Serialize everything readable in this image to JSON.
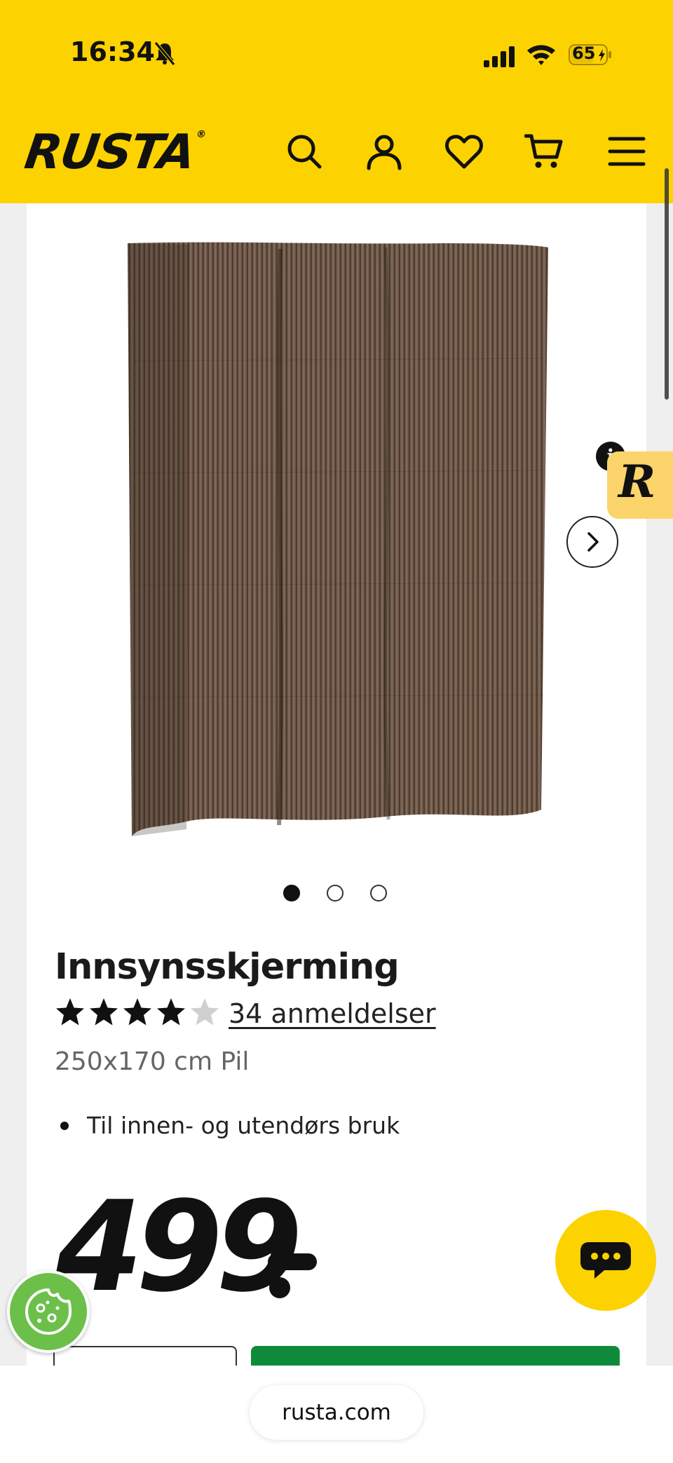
{
  "status_bar": {
    "time": "16:34",
    "battery": "65"
  },
  "header": {
    "logo": "RUSTA",
    "logo_mark": "®",
    "icons": [
      "search-icon",
      "account-icon",
      "heart-icon",
      "cart-icon",
      "menu-icon"
    ],
    "background": "#fdd201"
  },
  "gallery": {
    "image_subject": "willow privacy screen",
    "dots_total": 3,
    "active_dot": 1
  },
  "badge": {
    "letter": "R",
    "info": "i"
  },
  "product": {
    "title": "Innsynsskjerming",
    "rating": 4.5,
    "rating_max": 5,
    "reviews_label": "34 anmeldelser",
    "variant": "250x170 cm Pil",
    "features": [
      "Til innen- og utendørs bruk"
    ],
    "price": "499"
  },
  "colors": {
    "brand_yellow": "#fdd201",
    "cart_green": "#0f8a3a",
    "cookie_green": "#6cc04a"
  },
  "browser": {
    "url": "rusta.com"
  }
}
